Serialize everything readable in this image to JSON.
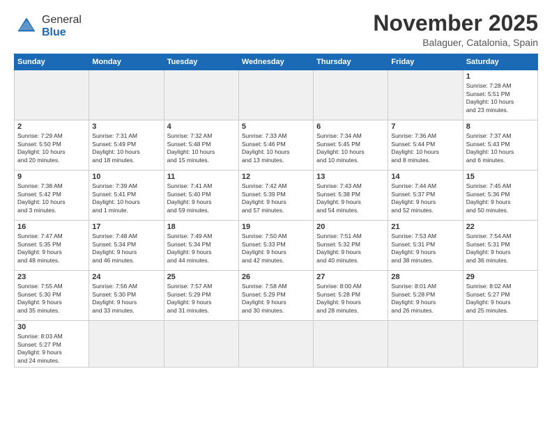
{
  "logo": {
    "text_general": "General",
    "text_blue": "Blue"
  },
  "title": "November 2025",
  "subtitle": "Balaguer, Catalonia, Spain",
  "headers": [
    "Sunday",
    "Monday",
    "Tuesday",
    "Wednesday",
    "Thursday",
    "Friday",
    "Saturday"
  ],
  "days": [
    {
      "num": "",
      "info": "",
      "empty": true
    },
    {
      "num": "",
      "info": "",
      "empty": true
    },
    {
      "num": "",
      "info": "",
      "empty": true
    },
    {
      "num": "",
      "info": "",
      "empty": true
    },
    {
      "num": "",
      "info": "",
      "empty": true
    },
    {
      "num": "",
      "info": "",
      "empty": true
    },
    {
      "num": "1",
      "info": "Sunrise: 7:28 AM\nSunset: 5:51 PM\nDaylight: 10 hours\nand 23 minutes."
    }
  ],
  "week2": [
    {
      "num": "2",
      "info": "Sunrise: 7:29 AM\nSunset: 5:50 PM\nDaylight: 10 hours\nand 20 minutes."
    },
    {
      "num": "3",
      "info": "Sunrise: 7:31 AM\nSunset: 5:49 PM\nDaylight: 10 hours\nand 18 minutes."
    },
    {
      "num": "4",
      "info": "Sunrise: 7:32 AM\nSunset: 5:48 PM\nDaylight: 10 hours\nand 15 minutes."
    },
    {
      "num": "5",
      "info": "Sunrise: 7:33 AM\nSunset: 5:46 PM\nDaylight: 10 hours\nand 13 minutes."
    },
    {
      "num": "6",
      "info": "Sunrise: 7:34 AM\nSunset: 5:45 PM\nDaylight: 10 hours\nand 10 minutes."
    },
    {
      "num": "7",
      "info": "Sunrise: 7:36 AM\nSunset: 5:44 PM\nDaylight: 10 hours\nand 8 minutes."
    },
    {
      "num": "8",
      "info": "Sunrise: 7:37 AM\nSunset: 5:43 PM\nDaylight: 10 hours\nand 6 minutes."
    }
  ],
  "week3": [
    {
      "num": "9",
      "info": "Sunrise: 7:38 AM\nSunset: 5:42 PM\nDaylight: 10 hours\nand 3 minutes."
    },
    {
      "num": "10",
      "info": "Sunrise: 7:39 AM\nSunset: 5:41 PM\nDaylight: 10 hours\nand 1 minute."
    },
    {
      "num": "11",
      "info": "Sunrise: 7:41 AM\nSunset: 5:40 PM\nDaylight: 9 hours\nand 59 minutes."
    },
    {
      "num": "12",
      "info": "Sunrise: 7:42 AM\nSunset: 5:39 PM\nDaylight: 9 hours\nand 57 minutes."
    },
    {
      "num": "13",
      "info": "Sunrise: 7:43 AM\nSunset: 5:38 PM\nDaylight: 9 hours\nand 54 minutes."
    },
    {
      "num": "14",
      "info": "Sunrise: 7:44 AM\nSunset: 5:37 PM\nDaylight: 9 hours\nand 52 minutes."
    },
    {
      "num": "15",
      "info": "Sunrise: 7:45 AM\nSunset: 5:36 PM\nDaylight: 9 hours\nand 50 minutes."
    }
  ],
  "week4": [
    {
      "num": "16",
      "info": "Sunrise: 7:47 AM\nSunset: 5:35 PM\nDaylight: 9 hours\nand 48 minutes."
    },
    {
      "num": "17",
      "info": "Sunrise: 7:48 AM\nSunset: 5:34 PM\nDaylight: 9 hours\nand 46 minutes."
    },
    {
      "num": "18",
      "info": "Sunrise: 7:49 AM\nSunset: 5:34 PM\nDaylight: 9 hours\nand 44 minutes."
    },
    {
      "num": "19",
      "info": "Sunrise: 7:50 AM\nSunset: 5:33 PM\nDaylight: 9 hours\nand 42 minutes."
    },
    {
      "num": "20",
      "info": "Sunrise: 7:51 AM\nSunset: 5:32 PM\nDaylight: 9 hours\nand 40 minutes."
    },
    {
      "num": "21",
      "info": "Sunrise: 7:53 AM\nSunset: 5:31 PM\nDaylight: 9 hours\nand 38 minutes."
    },
    {
      "num": "22",
      "info": "Sunrise: 7:54 AM\nSunset: 5:31 PM\nDaylight: 9 hours\nand 36 minutes."
    }
  ],
  "week5": [
    {
      "num": "23",
      "info": "Sunrise: 7:55 AM\nSunset: 5:30 PM\nDaylight: 9 hours\nand 35 minutes."
    },
    {
      "num": "24",
      "info": "Sunrise: 7:56 AM\nSunset: 5:30 PM\nDaylight: 9 hours\nand 33 minutes."
    },
    {
      "num": "25",
      "info": "Sunrise: 7:57 AM\nSunset: 5:29 PM\nDaylight: 9 hours\nand 31 minutes."
    },
    {
      "num": "26",
      "info": "Sunrise: 7:58 AM\nSunset: 5:29 PM\nDaylight: 9 hours\nand 30 minutes."
    },
    {
      "num": "27",
      "info": "Sunrise: 8:00 AM\nSunset: 5:28 PM\nDaylight: 9 hours\nand 28 minutes."
    },
    {
      "num": "28",
      "info": "Sunrise: 8:01 AM\nSunset: 5:28 PM\nDaylight: 9 hours\nand 26 minutes."
    },
    {
      "num": "29",
      "info": "Sunrise: 8:02 AM\nSunset: 5:27 PM\nDaylight: 9 hours\nand 25 minutes."
    }
  ],
  "week6": [
    {
      "num": "30",
      "info": "Sunrise: 8:03 AM\nSunset: 5:27 PM\nDaylight: 9 hours\nand 24 minutes."
    },
    {
      "num": "",
      "info": "",
      "empty": true
    },
    {
      "num": "",
      "info": "",
      "empty": true
    },
    {
      "num": "",
      "info": "",
      "empty": true
    },
    {
      "num": "",
      "info": "",
      "empty": true
    },
    {
      "num": "",
      "info": "",
      "empty": true
    },
    {
      "num": "",
      "info": "",
      "empty": true
    }
  ]
}
